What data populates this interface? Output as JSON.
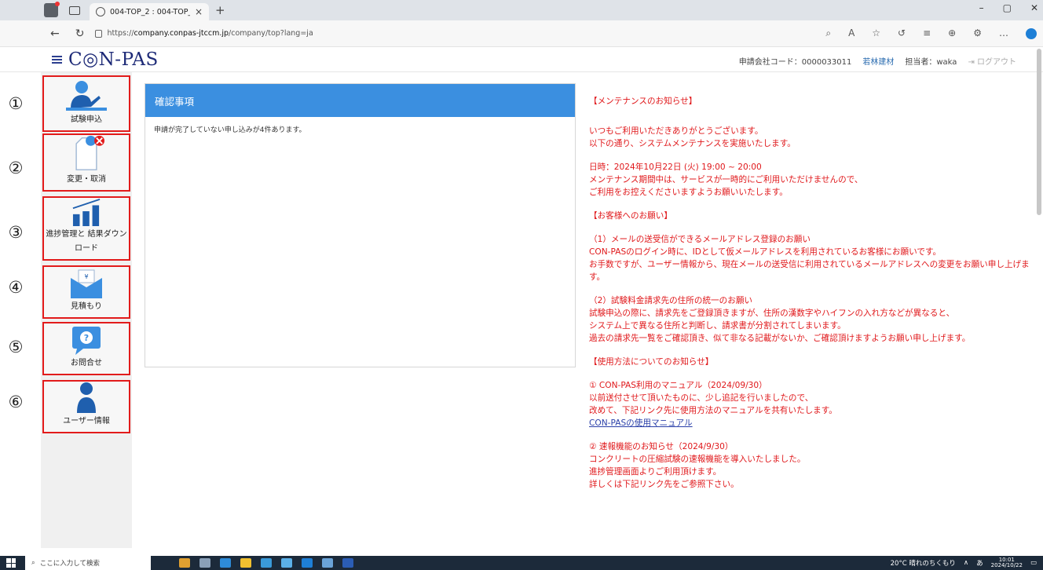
{
  "browser": {
    "tab_title": "004-TOP_2 : 004-TOP_2",
    "tab_close": "×",
    "new_tab": "+",
    "url_prefix": "https://",
    "url_domain": "company.conpas-jtccm.jp",
    "url_path": "/company/top?lang=ja",
    "window_controls": [
      "–",
      "▢",
      "✕"
    ]
  },
  "header": {
    "logo": "C◎N-PAS",
    "applicant_code": "申請会社コード：0000033011",
    "company_name": "若林建材",
    "user": "担当者：waka",
    "logout": "ログアウト"
  },
  "sidebar": {
    "items": [
      {
        "marker": "①",
        "label": "試験申込",
        "icon": "user-desk-icon"
      },
      {
        "marker": "②",
        "label": "変更・取消",
        "icon": "document-edit-cancel-icon"
      },
      {
        "marker": "③",
        "label": "進捗管理と 結果ダウンロード",
        "icon": "bar-chart-icon"
      },
      {
        "marker": "④",
        "label": "見積もり",
        "icon": "yen-envelope-icon"
      },
      {
        "marker": "⑤",
        "label": "お問合せ",
        "icon": "question-bubble-icon"
      },
      {
        "marker": "⑥",
        "label": "ユーザー情報",
        "icon": "user-icon"
      }
    ]
  },
  "panel": {
    "title": "確認事項",
    "message": "申請が完了していない申し込みが4件あります。"
  },
  "notice": {
    "heading": "【メンテナンスのお知らせ】",
    "intro": "いつもご利用いただきありがとうございます。\n以下の通り、システムメンテナンスを実施いたします。",
    "schedule": "日時：2024年10月22日 (火) 19:00 ~ 20:00\nメンテナンス期間中は、サービスが一時的にご利用いただけませんので、\nご利用をお控えくださいますようお願いいたします。",
    "request_heading": "【お客様へのお願い】",
    "request1": "（1）メールの送受信ができるメールアドレス登録のお願い\nCON-PASのログイン時に、IDとして仮メールアドレスを利用されているお客様にお願いです。\nお手数ですが、ユーザー情報から、現在メールの送受信に利用されているメールアドレスへの変更をお願い申し上げます。",
    "request2": "（2）試験料金請求先の住所の統一のお願い\n試験申込の際に、請求先をご登録頂きますが、住所の漢数字やハイフンの入れ方などが異なると、\nシステム上で異なる住所と判断し、請求書が分割されてしまいます。\n過去の請求先一覧をご確認頂き、似て非なる記載がないか、ご確認頂けますようお願い申し上げます。",
    "usage_heading": "【使用方法についてのお知らせ】",
    "usage1": "① CON-PAS利用のマニュアル（2024/09/30）\n以前送付させて頂いたものに、少し追記を行いましたので、\n改めて、下記リンク先に使用方法のマニュアルを共有いたします。",
    "manual_link": "CON-PASの使用マニュアル",
    "usage2": "② 速報機能のお知らせ（2024/9/30）\nコンクリートの圧縮試験の速報機能を導入いたしました。\n進捗管理画面よりご利用頂けます。\n詳しくは下記リンク先をご参照下さい。"
  },
  "taskbar": {
    "search_placeholder": "ここに入力して検索",
    "weather": "20°C 晴れのちくもり",
    "ime": "あ",
    "time": "10:01",
    "date": "2024/10/22"
  },
  "colors": {
    "panel_header": "#3b8fe0",
    "notice_text": "#e0181b",
    "highlight_border": "#e21b1b",
    "logo": "#1d2a77"
  }
}
